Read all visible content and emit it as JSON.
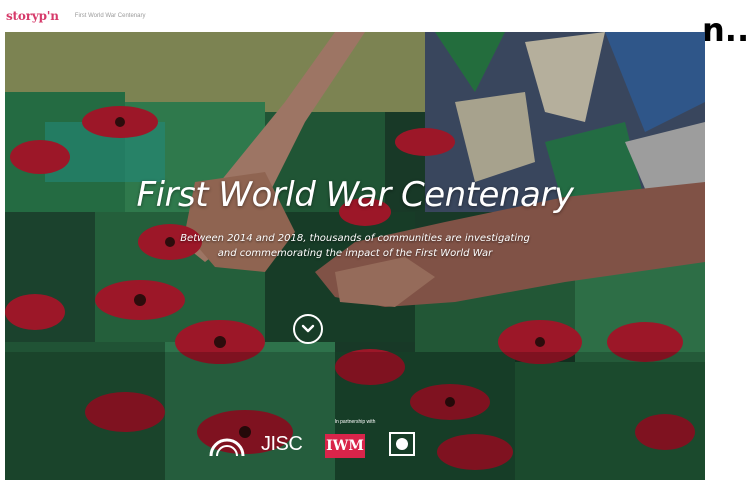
{
  "site": {
    "logo_text": "storyp'n",
    "breadcrumb": "First World War Centenary"
  },
  "overflow_title": "n...",
  "hero": {
    "title": "First World War Centenary",
    "subtitle": "Between 2014 and 2018, thousands of communities are investigating and commemorating the impact of the First World War",
    "partnership_label": "In partnership with",
    "partners": [
      "heritage-arch-logo",
      "JISC",
      "IWM",
      "square-logo"
    ]
  },
  "icons": {
    "scroll_down": "chevron-down-circle-icon"
  },
  "colors": {
    "brand": "#d63a6a",
    "iwm_red": "#d9244a",
    "poppy": "#c81e34",
    "felt_green": "#2e7d4f"
  }
}
